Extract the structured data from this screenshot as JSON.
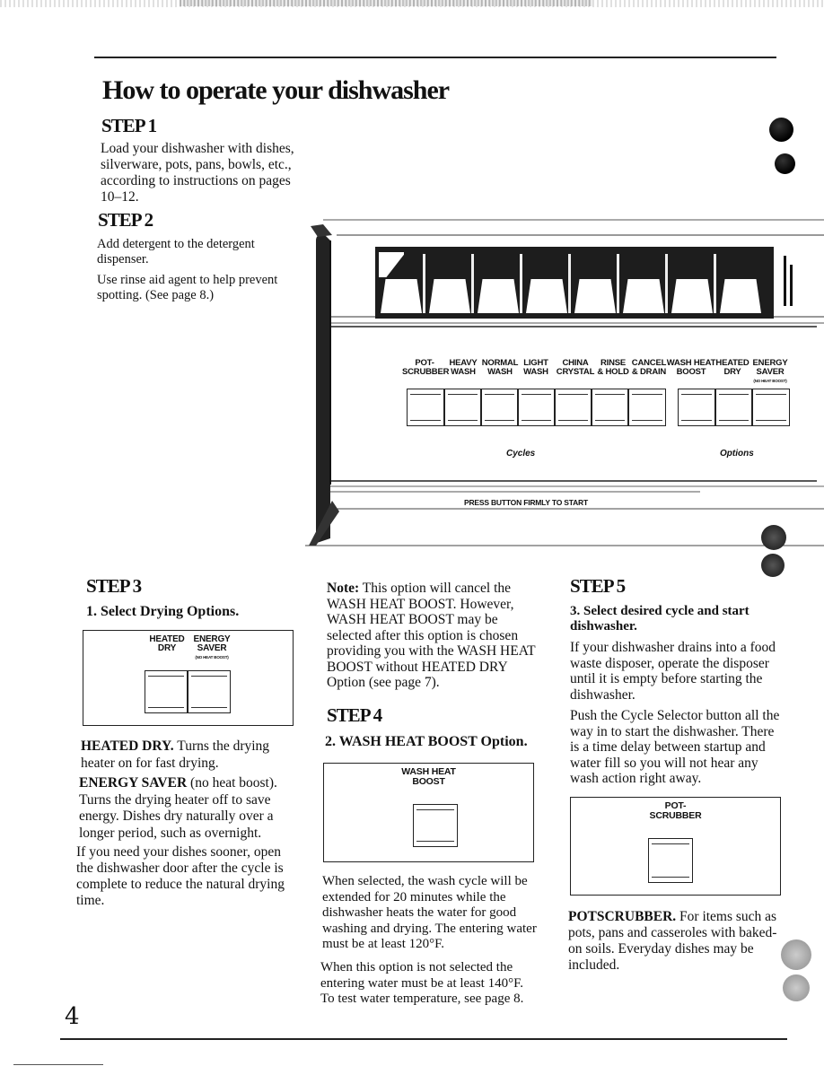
{
  "page": {
    "title": "How to operate your dishwasher",
    "page_number": "4"
  },
  "step1": {
    "heading": "STEP 1",
    "text_lines": [
      "Load your dishwasher with dishes,",
      "silverware, pots, pans, bowls, etc.,",
      "according to instructions on pages",
      "10–12."
    ]
  },
  "step2": {
    "heading": "STEP 2",
    "para1_lines": [
      "Add detergent to the detergent",
      "dispenser."
    ],
    "para2_lines": [
      "Use rinse aid agent to help prevent",
      "spotting. (See page 8.)"
    ]
  },
  "control_panel": {
    "cycles": [
      {
        "line1": "POT-",
        "line2": "SCRUBBER"
      },
      {
        "line1": "HEAVY",
        "line2": "WASH"
      },
      {
        "line1": "NORMAL",
        "line2": "WASH"
      },
      {
        "line1": "LIGHT",
        "line2": "WASH"
      },
      {
        "line1": "CHINA",
        "line2": "CRYSTAL"
      },
      {
        "line1": "RINSE",
        "line2": "& HOLD"
      },
      {
        "line1": "CANCEL",
        "line2": "& DRAIN"
      }
    ],
    "options": [
      {
        "line1": "WASH HEAT",
        "line2": "BOOST",
        "note": ""
      },
      {
        "line1": "HEATED",
        "line2": "DRY",
        "note": ""
      },
      {
        "line1": "ENERGY",
        "line2": "SAVER",
        "note": "(NO HEAT BOOST)"
      }
    ],
    "cycles_label": "Cycles",
    "options_label": "Options",
    "start_instruction": "PRESS BUTTON FIRMLY TO START"
  },
  "step3": {
    "heading": "STEP 3",
    "subheading": "1. Select Drying Options.",
    "panel": {
      "label1_line1": "HEATED",
      "label1_line2": "DRY",
      "label2_line1": "ENERGY",
      "label2_line2": "SAVER",
      "note": "(NO HEAT BOOST)"
    },
    "heated_dry_term": "HEATED DRY.",
    "heated_dry_text": " Turns the drying heater on for fast drying.",
    "energy_saver_term": "ENERGY SAVER",
    "energy_saver_text": " (no heat boost). Turns the drying heater off to save energy. Dishes dry naturally over a longer period, such as overnight.",
    "sooner_text": "If you need your dishes sooner, open the dishwasher door after the cycle is complete to reduce the natural drying time."
  },
  "note_col": {
    "note_label": "Note:",
    "note_text": " This option will cancel the WASH HEAT BOOST. However, WASH HEAT BOOST may be selected after this option is chosen providing you with the WASH HEAT BOOST without HEATED DRY Option (see page 7)."
  },
  "step4": {
    "heading": "STEP 4",
    "subheading": "2. WASH HEAT BOOST Option.",
    "panel": {
      "line1": "WASH HEAT",
      "line2": "BOOST"
    },
    "para1": "When selected, the wash cycle will be extended for 20 minutes while the dishwasher heats the water for good washing and drying. The entering water must be at least 120°F.",
    "para2": "When this option is not selected the entering water must be at least 140°F. To test water temperature, see page 8."
  },
  "step5": {
    "heading": "STEP 5",
    "subheading": "3. Select desired cycle and start dishwasher.",
    "para1": "If your dishwasher drains into a food waste disposer, operate the disposer until it is empty before starting the dishwasher.",
    "para2": "Push the Cycle Selector button all the way in to start the dishwasher. There is a time delay between startup and water fill so you will not hear any wash action right away.",
    "panel": {
      "line1": "POT-",
      "line2": "SCRUBBER"
    },
    "potscrubber_term": "POTSCRUBBER.",
    "potscrubber_text": " For items such as pots, pans and casseroles with baked-on soils. Everyday dishes may be included."
  }
}
